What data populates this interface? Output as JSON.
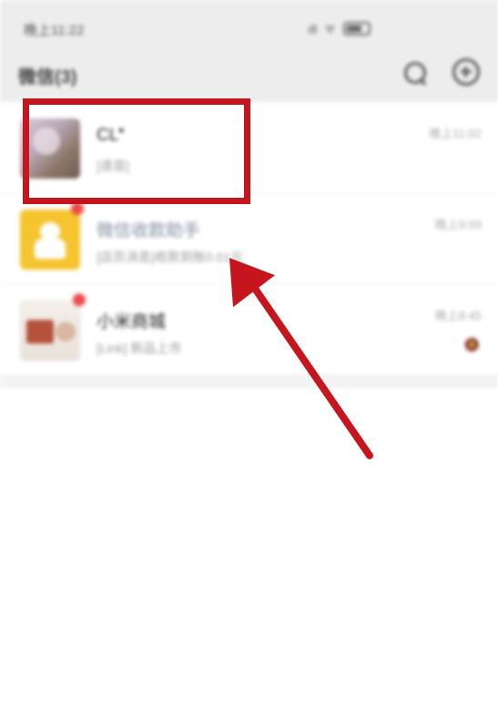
{
  "status_bar": {
    "time": "晚上11:22",
    "signal": "ıll",
    "wifi": "ᯤ"
  },
  "nav": {
    "title": "微信(3)",
    "search_icon": "search-icon",
    "add_icon": "plus-circle-icon"
  },
  "chats": [
    {
      "name": "CL",
      "name_suffix": "♥",
      "message": "[语音]",
      "time": "晚上11:02",
      "avatar": "photo-avatar"
    },
    {
      "name": "微信收款助手",
      "message": "[店员消息]收款到账0.01元",
      "time": "晚上9:59",
      "avatar": "yellow-avatar"
    },
    {
      "name": "小米商城",
      "message": "[Link] 新品上市",
      "time": "晚上8:45",
      "avatar": "shop-avatar",
      "mute": "🔕"
    }
  ],
  "annotation": {
    "color": "#c4161c"
  }
}
